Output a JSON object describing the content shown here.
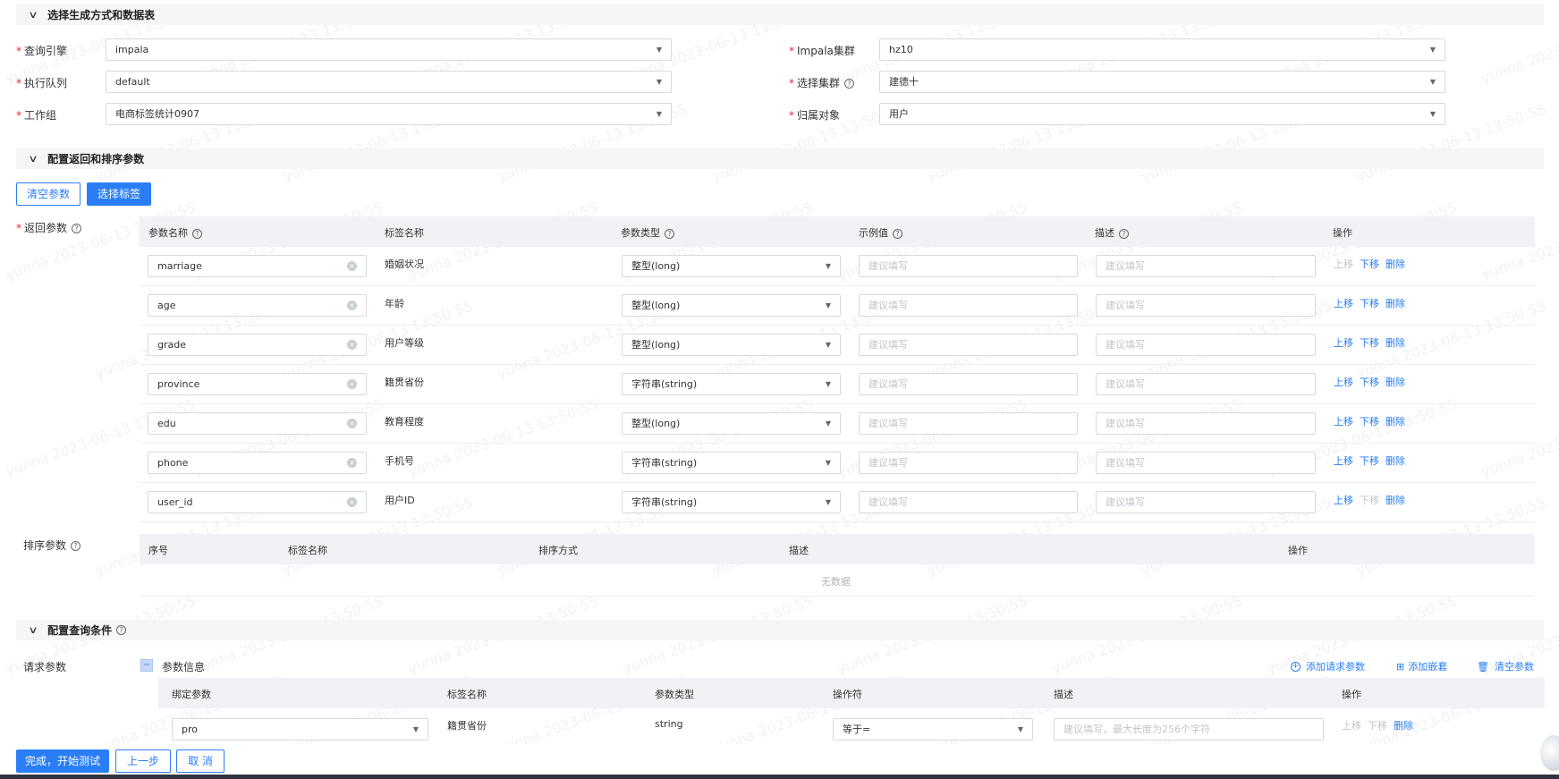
{
  "sections": {
    "gen": "选择生成方式和数据表",
    "ret": "配置返回和排序参数",
    "cond": "配置查询条件"
  },
  "form": {
    "engine_label": "查询引擎",
    "engine_value": "impala",
    "queue_label": "执行队列",
    "queue_value": "default",
    "group_label": "工作组",
    "group_value": "电商标签统计0907",
    "cluster_label": "Impala集群",
    "cluster_value": "hz10",
    "select_cluster_label": "选择集群",
    "select_cluster_value": "建德十",
    "owner_label": "归属对象",
    "owner_value": "用户"
  },
  "buttons": {
    "clear_params": "清空参数",
    "select_tags": "选择标签",
    "finish": "完成，开始测试",
    "prev": "上一步",
    "cancel": "取 消"
  },
  "return_params": {
    "label": "返回参数",
    "headers": [
      "参数名称",
      "标签名称",
      "参数类型",
      "示例值",
      "描述",
      "操作"
    ],
    "placeholder": "建议填写",
    "rows": [
      {
        "name": "marriage",
        "tag": "婚姻状况",
        "type": "整型(long)",
        "up": false,
        "down": true
      },
      {
        "name": "age",
        "tag": "年龄",
        "type": "整型(long)",
        "up": true,
        "down": true
      },
      {
        "name": "grade",
        "tag": "用户等级",
        "type": "整型(long)",
        "up": true,
        "down": true
      },
      {
        "name": "province",
        "tag": "籍贯省份",
        "type": "字符串(string)",
        "up": true,
        "down": true
      },
      {
        "name": "edu",
        "tag": "教育程度",
        "type": "整型(long)",
        "up": true,
        "down": true
      },
      {
        "name": "phone",
        "tag": "手机号",
        "type": "字符串(string)",
        "up": true,
        "down": true
      },
      {
        "name": "user_id",
        "tag": "用户ID",
        "type": "字符串(string)",
        "up": true,
        "down": false
      }
    ],
    "op_up": "上移",
    "op_down": "下移",
    "op_delete": "删除"
  },
  "sort_params": {
    "label": "排序参数",
    "headers": [
      "序号",
      "标签名称",
      "排序方式",
      "描述",
      "操作"
    ],
    "empty": "无数据"
  },
  "request": {
    "label": "请求参数",
    "group_title": "参数信息",
    "add_request": "添加请求参数",
    "add_nested": "添加嵌套",
    "clear": "清空参数",
    "headers": [
      "绑定参数",
      "标签名称",
      "参数类型",
      "操作符",
      "描述",
      "操作"
    ],
    "row": {
      "bind": "pro",
      "tag": "籍贯省份",
      "type": "string",
      "operator": "等于=",
      "desc_placeholder": "建议填写，最大长度为256个字符"
    }
  },
  "watermark": "yunna 2023-06-13 13:50:55",
  "colors": {
    "primary": "#2a7ef5",
    "required": "#f5222d"
  }
}
